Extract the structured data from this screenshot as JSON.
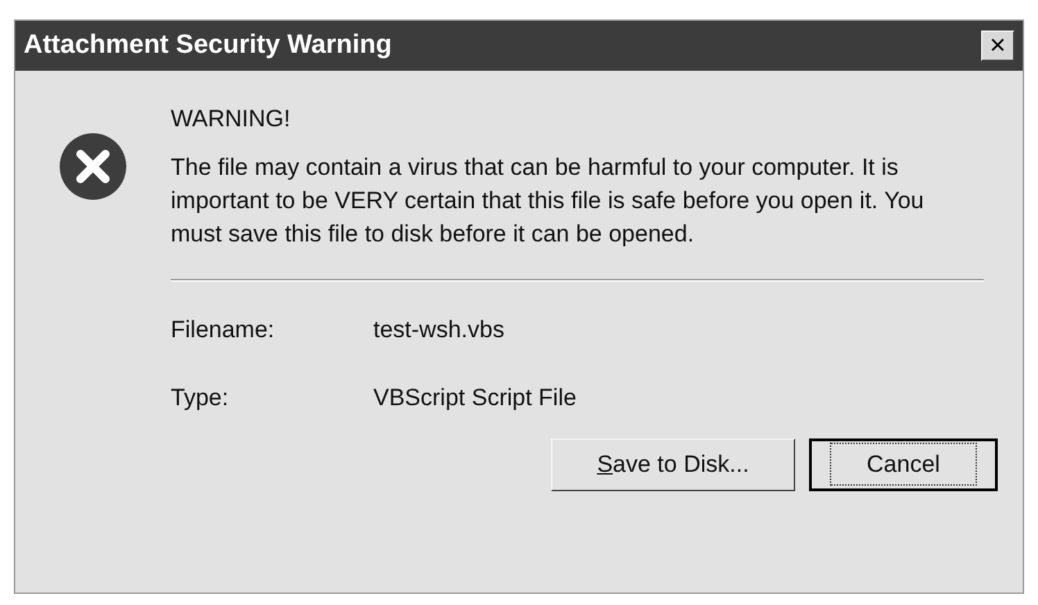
{
  "window": {
    "title": "Attachment Security Warning",
    "close": "×"
  },
  "heading": "WARNING!",
  "message": "The file may contain a virus that can be harmful to your computer. It is important to be VERY certain that this file is safe before you open it. You must save this file to disk before it can be opened.",
  "fields": [
    {
      "label": "Filename:",
      "value": "test-wsh.vbs"
    },
    {
      "label": "Type:",
      "value": "VBScript Script File"
    }
  ],
  "buttons": [
    {
      "label": "Save to Disk...",
      "underline_first_letter": true,
      "default": false
    },
    {
      "label": "Cancel",
      "underline_first_letter": false,
      "default": true
    }
  ]
}
